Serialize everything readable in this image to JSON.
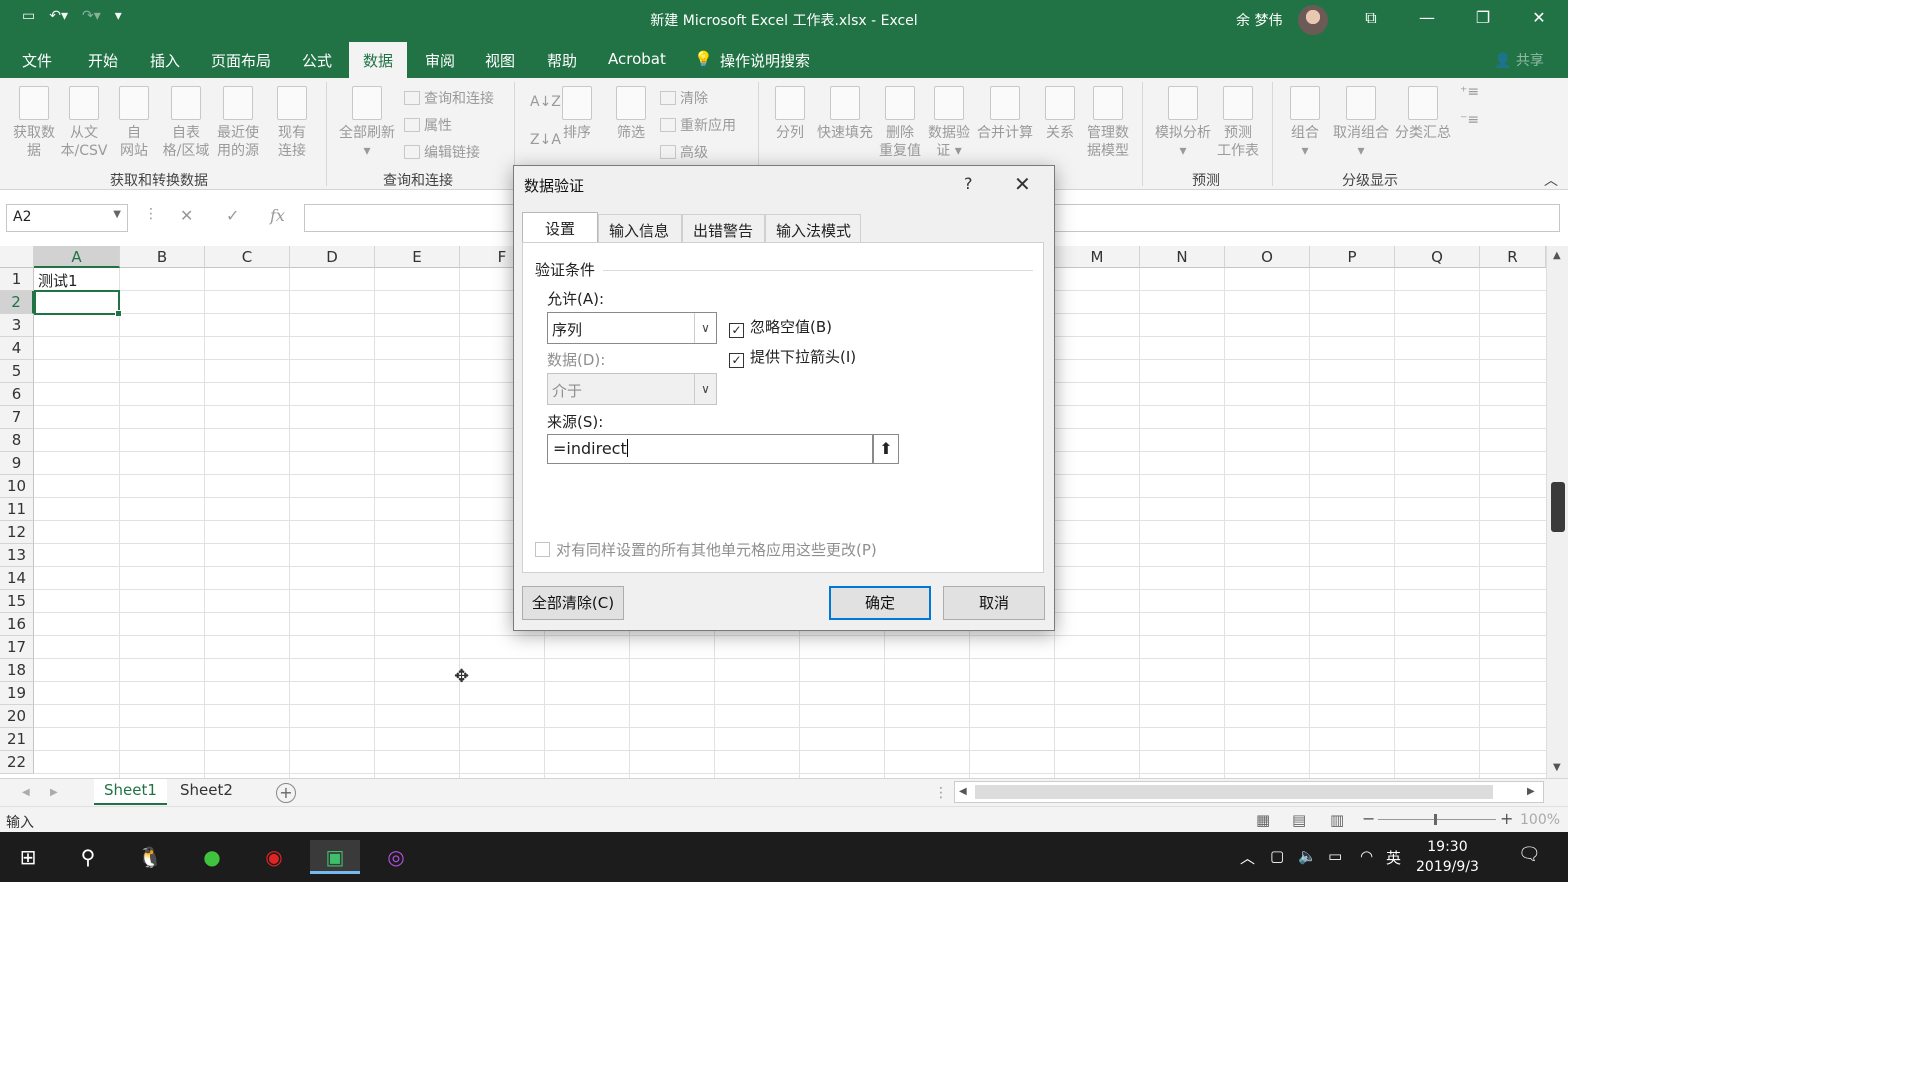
{
  "window": {
    "title": "新建 Microsoft Excel 工作表.xlsx  -  Excel",
    "user": "余 梦伟"
  },
  "ribbon_tabs": [
    "文件",
    "开始",
    "插入",
    "页面布局",
    "公式",
    "数据",
    "审阅",
    "视图",
    "帮助",
    "Acrobat",
    "操作说明搜索"
  ],
  "active_tab": "数据",
  "share_label": "共享",
  "ribbon": {
    "get_data": [
      "获取数",
      "据"
    ],
    "from_text": [
      "从文",
      "本/CSV"
    ],
    "from_web": [
      "自",
      "网站"
    ],
    "from_table": [
      "自表",
      "格/区域"
    ],
    "recent_sources": [
      "最近使",
      "用的源"
    ],
    "existing_conn": [
      "现有",
      "连接"
    ],
    "refresh_all": [
      "全部刷新"
    ],
    "queries_conn": "查询和连接",
    "properties": "属性",
    "edit_links": "编辑链接",
    "sort": "排序",
    "filter": "筛选",
    "clear": "清除",
    "reapply": "重新应用",
    "advanced": "高级",
    "text_to_col": [
      "分列"
    ],
    "flash_fill": [
      "快速填充"
    ],
    "remove_dup": [
      "删除",
      "重复值"
    ],
    "data_validation": [
      "数据验",
      "证"
    ],
    "consolidate": [
      "合并计算"
    ],
    "relations": [
      "关系"
    ],
    "data_model": [
      "管理数",
      "据模型"
    ],
    "what_if": [
      "模拟分析"
    ],
    "forecast": [
      "预测",
      "工作表"
    ],
    "group": [
      "组合"
    ],
    "ungroup": [
      "取消组合"
    ],
    "subtotal": [
      "分类汇总"
    ],
    "groups": {
      "get_transform": "获取和转换数据",
      "queries": "查询和连接",
      "forecast": "预测",
      "outline": "分级显示"
    }
  },
  "formula_bar": {
    "name_box": "A2",
    "fx": "fx",
    "value": ""
  },
  "grid": {
    "columns": [
      "A",
      "B",
      "C",
      "D",
      "E",
      "F",
      "M",
      "N",
      "O",
      "P",
      "Q",
      "R"
    ],
    "rows": [
      "1",
      "2",
      "3",
      "4",
      "5",
      "6",
      "7",
      "8",
      "9",
      "10",
      "11",
      "12",
      "13",
      "14",
      "15",
      "16",
      "17",
      "18",
      "19",
      "20",
      "21",
      "22"
    ],
    "cell_A1": "测试1",
    "selected_cell": "A2"
  },
  "sheets": [
    "Sheet1",
    "Sheet2"
  ],
  "active_sheet": "Sheet1",
  "status": {
    "mode": "输入",
    "zoom": "100%"
  },
  "dialog": {
    "title": "数据验证",
    "help": "?",
    "tabs": [
      "设置",
      "输入信息",
      "出错警告",
      "输入法模式"
    ],
    "active_tab": "设置",
    "section_title": "验证条件",
    "allow_label": "允许(A):",
    "allow_value": "序列",
    "data_label": "数据(D):",
    "data_value": "介于",
    "ignore_blank": {
      "label": "忽略空值(B)",
      "checked": true
    },
    "in_cell_dropdown": {
      "label": "提供下拉箭头(I)",
      "checked": true
    },
    "source_label": "来源(S):",
    "source_value": "=indirect",
    "apply_all": {
      "label": "对有同样设置的所有其他单元格应用这些更改(P)",
      "checked": false
    },
    "clear_all": "全部清除(C)",
    "ok": "确定",
    "cancel": "取消"
  },
  "taskbar": {
    "time": "19:30",
    "date": "2019/9/3",
    "ime": "英"
  }
}
